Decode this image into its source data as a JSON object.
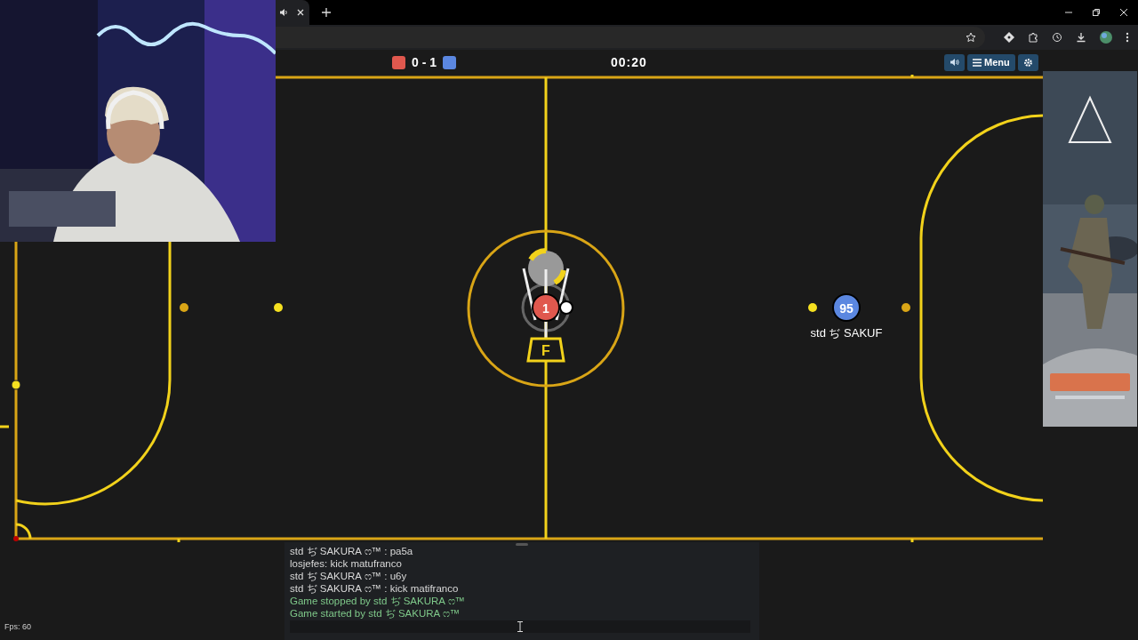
{
  "teams": [
    {
      "color": "#e0584e"
    },
    {
      "color": "#5b87e0"
    }
  ],
  "score": "0 - 1",
  "timer": "00:20",
  "menu_button": "Menu",
  "center_logo_letter": "F",
  "players": [
    {
      "number": "1",
      "color": "#e0584e"
    },
    {
      "number": "95",
      "color": "#5b87e0",
      "name": "std ぢ SAKUF"
    }
  ],
  "chat": {
    "messages": [
      {
        "kind": "chat",
        "text": "std ぢ SAKURA ෆ™ : pa5a"
      },
      {
        "kind": "chat",
        "text": "losjefes: kick matufranco"
      },
      {
        "kind": "chat",
        "text": "std ぢ SAKURA ෆ™ : u6y"
      },
      {
        "kind": "chat",
        "text": "std ぢ SAKURA ෆ™ : kick matifranco"
      },
      {
        "kind": "notice",
        "text": "Game stopped by std ぢ SAKURA ෆ™"
      },
      {
        "kind": "notice",
        "text": "Game started by std ぢ SAKURA ෆ™"
      }
    ]
  },
  "fps": "Fps: 60"
}
